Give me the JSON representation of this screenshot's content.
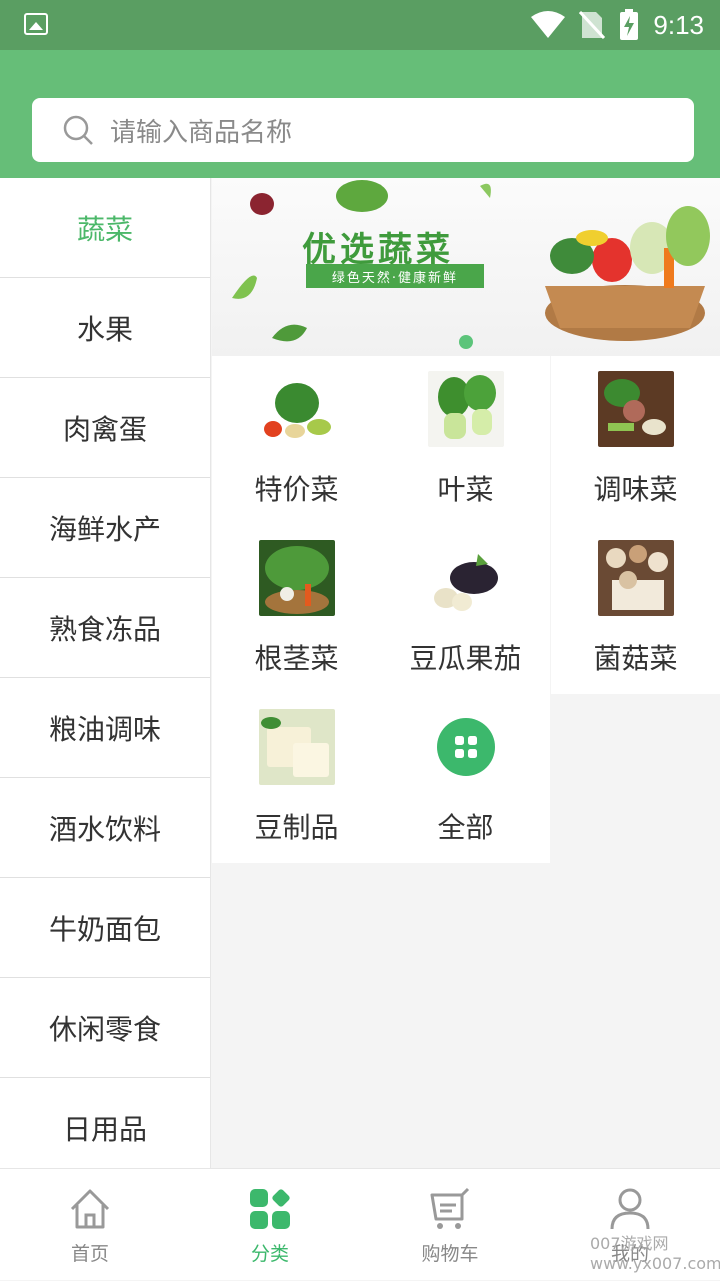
{
  "status": {
    "time": "9:13"
  },
  "search": {
    "placeholder": "请输入商品名称"
  },
  "sidebar": {
    "items": [
      {
        "label": "蔬菜",
        "active": true
      },
      {
        "label": "水果"
      },
      {
        "label": "肉禽蛋"
      },
      {
        "label": "海鲜水产"
      },
      {
        "label": "熟食冻品"
      },
      {
        "label": "粮油调味"
      },
      {
        "label": "酒水饮料"
      },
      {
        "label": "牛奶面包"
      },
      {
        "label": "休闲零食"
      },
      {
        "label": "日用品"
      }
    ]
  },
  "banner": {
    "title": "优选蔬菜",
    "tagline": "绿色天然·健康新鲜"
  },
  "categories": [
    {
      "label": "特价菜",
      "icon": "mixed-vegetables-image"
    },
    {
      "label": "叶菜",
      "icon": "bok-choy-image"
    },
    {
      "label": "调味菜",
      "icon": "seasoning-vegetables-image"
    },
    {
      "label": "根茎菜",
      "icon": "root-vegetables-image"
    },
    {
      "label": "豆瓜果茄",
      "icon": "eggplant-image"
    },
    {
      "label": "菌菇菜",
      "icon": "mushrooms-image"
    },
    {
      "label": "豆制品",
      "icon": "tofu-image"
    },
    {
      "label": "全部",
      "icon": "grid-icon"
    }
  ],
  "tabbar": {
    "tabs": [
      {
        "label": "首页",
        "icon": "home-icon"
      },
      {
        "label": "分类",
        "icon": "category-icon",
        "active": true
      },
      {
        "label": "购物车",
        "icon": "cart-icon"
      },
      {
        "label": "我的",
        "icon": "user-icon"
      }
    ]
  },
  "watermark": "007游戏网 www.yx007.com",
  "colors": {
    "header": "#66be78",
    "accent": "#3cb86c",
    "statusbar": "#5a9e62"
  }
}
